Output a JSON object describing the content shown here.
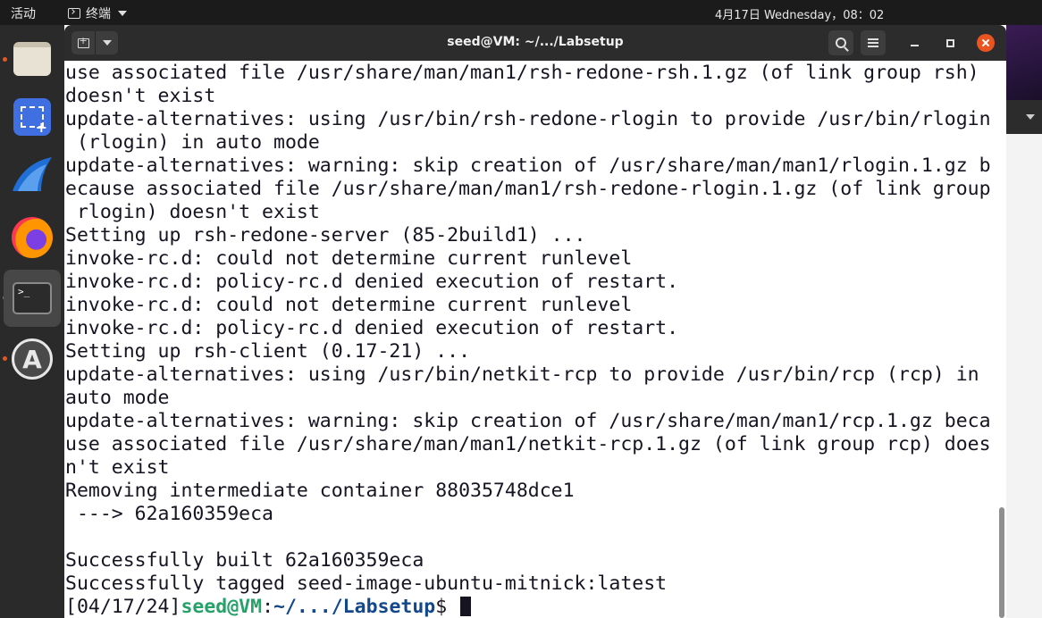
{
  "topbar": {
    "activities": "活动",
    "app_name": "终端",
    "clock": "4月17日 Wednesday，08：02"
  },
  "dock": {
    "items": [
      "files",
      "screenshot",
      "wireshark",
      "firefox",
      "terminal",
      "software"
    ]
  },
  "window": {
    "title": "seed@VM: ~/.../Labsetup"
  },
  "terminal": {
    "lines": [
      "use associated file /usr/share/man/man1/rsh-redone-rsh.1.gz (of link group rsh)",
      "doesn't exist",
      "update-alternatives: using /usr/bin/rsh-redone-rlogin to provide /usr/bin/rlogin",
      " (rlogin) in auto mode",
      "update-alternatives: warning: skip creation of /usr/share/man/man1/rlogin.1.gz b",
      "ecause associated file /usr/share/man/man1/rsh-redone-rlogin.1.gz (of link group",
      " rlogin) doesn't exist",
      "Setting up rsh-redone-server (85-2build1) ...",
      "invoke-rc.d: could not determine current runlevel",
      "invoke-rc.d: policy-rc.d denied execution of restart.",
      "invoke-rc.d: could not determine current runlevel",
      "invoke-rc.d: policy-rc.d denied execution of restart.",
      "Setting up rsh-client (0.17-21) ...",
      "update-alternatives: using /usr/bin/netkit-rcp to provide /usr/bin/rcp (rcp) in",
      "auto mode",
      "update-alternatives: warning: skip creation of /usr/share/man/man1/rcp.1.gz beca",
      "use associated file /usr/share/man/man1/netkit-rcp.1.gz (of link group rcp) does",
      "n't exist",
      "Removing intermediate container 88035748dce1",
      " ---> 62a160359eca",
      "",
      "Successfully built 62a160359eca",
      "Successfully tagged seed-image-ubuntu-mitnick:latest"
    ],
    "prompt": {
      "date": "[04/17/24]",
      "user": "seed@VM",
      "sep": ":",
      "path": "~/.../Labsetup",
      "symbol": "$ "
    }
  },
  "colors": {
    "accent": "#e95420",
    "prompt_user": "#26a269",
    "prompt_path": "#12488b"
  }
}
